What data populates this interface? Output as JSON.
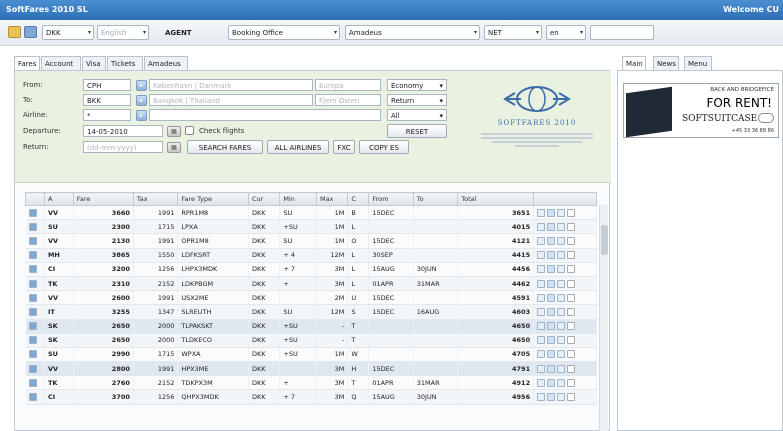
{
  "window": {
    "app_title": "SoftFares 2010 SL",
    "welcome": "Welcome CU"
  },
  "toolbar": {
    "pcc": "DKK",
    "language": "English",
    "mode_label": "AGENT",
    "office": "Booking Office",
    "gds": "Amadeus",
    "fare_kind": "NET",
    "lang_code": "en"
  },
  "left_tabs": [
    "Fares",
    "Account",
    "Visa",
    "Tickets",
    "Amadeus"
  ],
  "right_tabs": [
    "Main",
    "News",
    "Menu"
  ],
  "form": {
    "from_label": "From:",
    "from_code": "CPH",
    "from_city": "København | Danmark",
    "from_airport": "Europa",
    "to_label": "To:",
    "to_code": "BKK",
    "to_city": "Bangkok | Thailand",
    "to_airport": "Fjern Østen",
    "airline_label": "Airline:",
    "airline_value": "*",
    "departure_label": "Departure:",
    "departure_value": "14-05-2010",
    "check_flights": "Check flights",
    "return_label": "Return:",
    "return_hint": "(dd-mm-yyyy)",
    "class_value": "Economy",
    "trip_value": "Return",
    "all_value": "All",
    "search_button": "SEARCH FARES",
    "all_airlines_button": "ALL AIRLINES",
    "fxc_button": "FXC",
    "copy_button": "COPY ES",
    "reset_button": "RESET"
  },
  "logo": {
    "name": "SOFTFARES 2010"
  },
  "ad": {
    "line1": "BACK AND BRIDGEFICE",
    "line2": "FOR RENT!",
    "line3": "SOFTSUITCASE",
    "phone": "+45 33 36 88 86"
  },
  "grid": {
    "headers": [
      "A",
      "Fare",
      "Tax",
      "Fare Type",
      "Cur",
      "Min",
      "Max",
      "C",
      "From",
      "To",
      "Total"
    ],
    "rows": [
      {
        "airline": "VV",
        "fare": "3660",
        "tax": "1991",
        "type": "RPR1M8",
        "cur": "DKK",
        "min": "SU",
        "max": "1M",
        "cls": "B",
        "from": "15DEC",
        "to": "",
        "total": "3651"
      },
      {
        "airline": "SU",
        "fare": "2300",
        "tax": "1715",
        "type": "LPXA",
        "cur": "DKK",
        "min": "+SU",
        "max": "1M",
        "cls": "L",
        "from": "",
        "to": "",
        "total": "4015"
      },
      {
        "airline": "VV",
        "fare": "2130",
        "tax": "1991",
        "type": "OPR1M8",
        "cur": "DKK",
        "min": "SU",
        "max": "1M",
        "cls": "O",
        "from": "15DEC",
        "to": "",
        "total": "4121"
      },
      {
        "airline": "MH",
        "fare": "3865",
        "tax": "1550",
        "type": "LDFKSRT",
        "cur": "DKK",
        "min": "+ 4",
        "max": "12M",
        "cls": "L",
        "from": "30SEP",
        "to": "",
        "total": "4415"
      },
      {
        "airline": "CI",
        "fare": "3200",
        "tax": "1256",
        "type": "LHPX3MDK",
        "cur": "DKK",
        "min": "+ 7",
        "max": "3M",
        "cls": "L",
        "from": "15AUG",
        "to": "30JUN",
        "total": "4456"
      },
      {
        "airline": "TK",
        "fare": "2310",
        "tax": "2152",
        "type": "LDKPBGM",
        "cur": "DKK",
        "min": "+",
        "max": "3M",
        "cls": "L",
        "from": "01APR",
        "to": "31MAR",
        "total": "4462"
      },
      {
        "airline": "VV",
        "fare": "2600",
        "tax": "1991",
        "type": "USX2ME",
        "cur": "DKK",
        "min": "",
        "max": "2M",
        "cls": "U",
        "from": "15DEC",
        "to": "",
        "total": "4591"
      },
      {
        "airline": "IT",
        "fare": "3255",
        "tax": "1347",
        "type": "SLREUTH",
        "cur": "DKK",
        "min": "SU",
        "max": "12M",
        "cls": "S",
        "from": "15DEC",
        "to": "16AUG",
        "total": "4603"
      },
      {
        "airline": "SK",
        "fare": "2650",
        "tax": "2000",
        "type": "TLPAKSKT",
        "cur": "DKK",
        "min": "+SU",
        "max": "-",
        "cls": "T",
        "from": "",
        "to": "",
        "total": "4650"
      },
      {
        "airline": "SK",
        "fare": "2650",
        "tax": "2000",
        "type": "TLDKECO",
        "cur": "DKK",
        "min": "+SU",
        "max": "-",
        "cls": "T",
        "from": "",
        "to": "",
        "total": "4650"
      },
      {
        "airline": "SU",
        "fare": "2990",
        "tax": "1715",
        "type": "WPXA",
        "cur": "DKK",
        "min": "+SU",
        "max": "1M",
        "cls": "W",
        "from": "",
        "to": "",
        "total": "4705"
      },
      {
        "airline": "VV",
        "fare": "2800",
        "tax": "1991",
        "type": "HPX3ME",
        "cur": "DKK",
        "min": "",
        "max": "3M",
        "cls": "H",
        "from": "15DEC",
        "to": "",
        "total": "4791"
      },
      {
        "airline": "TK",
        "fare": "2760",
        "tax": "2152",
        "type": "TDKPX3M",
        "cur": "DKK",
        "min": "+",
        "max": "3M",
        "cls": "T",
        "from": "01APR",
        "to": "31MAR",
        "total": "4912"
      },
      {
        "airline": "CI",
        "fare": "3700",
        "tax": "1256",
        "type": "QHPX3MDK",
        "cur": "DKK",
        "min": "+ 7",
        "max": "3M",
        "cls": "Q",
        "from": "15AUG",
        "to": "30JUN",
        "total": "4956"
      }
    ]
  }
}
